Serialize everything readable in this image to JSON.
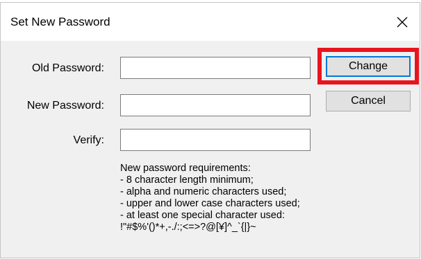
{
  "window": {
    "title": "Set New Password",
    "close_icon": "close-icon"
  },
  "form": {
    "old_password": {
      "label": "Old Password:",
      "value": ""
    },
    "new_password": {
      "label": "New Password:",
      "value": ""
    },
    "verify": {
      "label": "Verify:",
      "value": ""
    }
  },
  "buttons": {
    "change_label": "Change",
    "cancel_label": "Cancel"
  },
  "highlight": {
    "color": "#e8141e",
    "target": "change-button"
  },
  "requirements": {
    "heading": "New password requirements:",
    "items": [
      "- 8 character length minimum;",
      "- alpha and numeric characters used;",
      "- upper and lower case characters used;",
      "- at least one special character used:",
      "!\"#$%'()*+,-./:;<=>?@[¥]^_`{|}~"
    ]
  }
}
